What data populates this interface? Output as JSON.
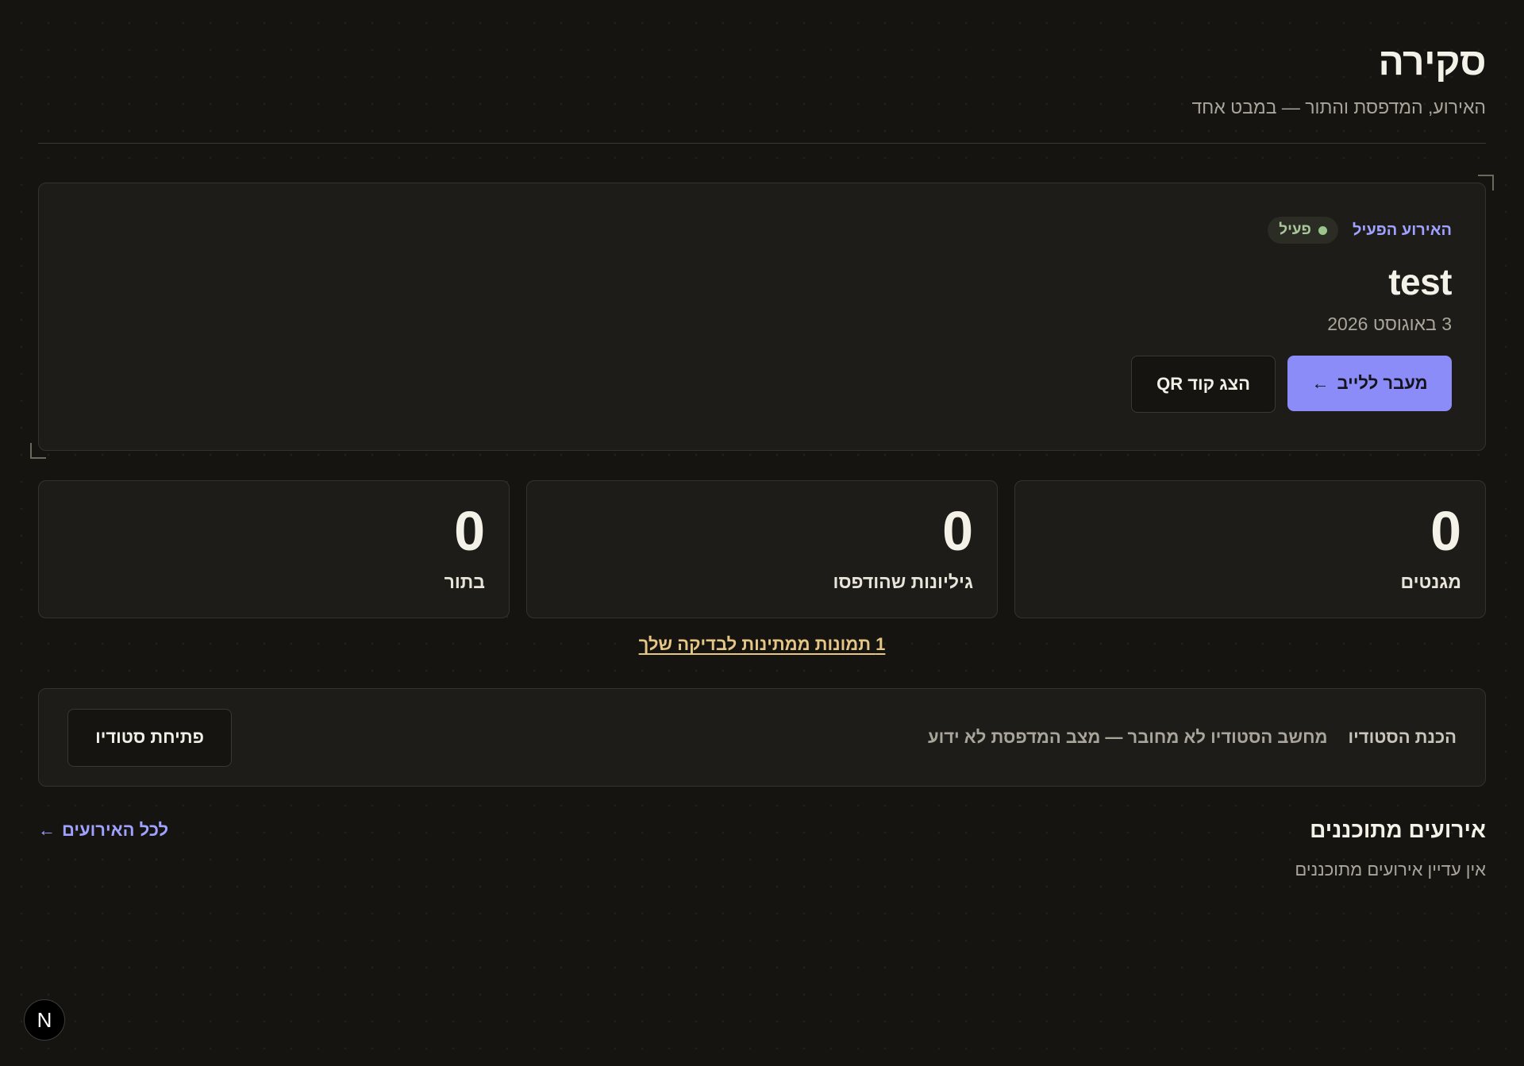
{
  "header": {
    "title": "סקירה",
    "subtitle": "האירוע, המדפסת והתור — במבט אחד"
  },
  "active_event": {
    "label": "האירוע הפעיל",
    "status": "פעיל",
    "name": "test",
    "date": "3 באוגוסט 2026",
    "go_live_label": "מעבר ללייב",
    "go_live_arrow": "←",
    "qr_label": "הצג קוד QR"
  },
  "stats": [
    {
      "value": "0",
      "label": "מגנטים"
    },
    {
      "value": "0",
      "label": "גיליונות שהודפסו"
    },
    {
      "value": "0",
      "label": "בתור"
    }
  ],
  "review_link": "1 תמונות ממתינות לבדיקה שלך",
  "studio": {
    "label": "הכנת הסטודיו",
    "status": "מחשב הסטודיו לא מחובר — מצב המדפסת לא ידוע",
    "open_label": "פתיחת סטודיו"
  },
  "upcoming": {
    "title": "אירועים מתוכננים",
    "all_link": "לכל האירועים",
    "all_link_arrow": "←",
    "empty_text": "אין עדיין אירועים מתוכננים"
  },
  "nextjs_badge": "N",
  "colors": {
    "background": "#151410",
    "card": "#1d1c18",
    "accent": "#8b8cf8",
    "link": "#9fa3ff",
    "warning_link": "#e6c684",
    "status_green": "#9cc58e"
  }
}
